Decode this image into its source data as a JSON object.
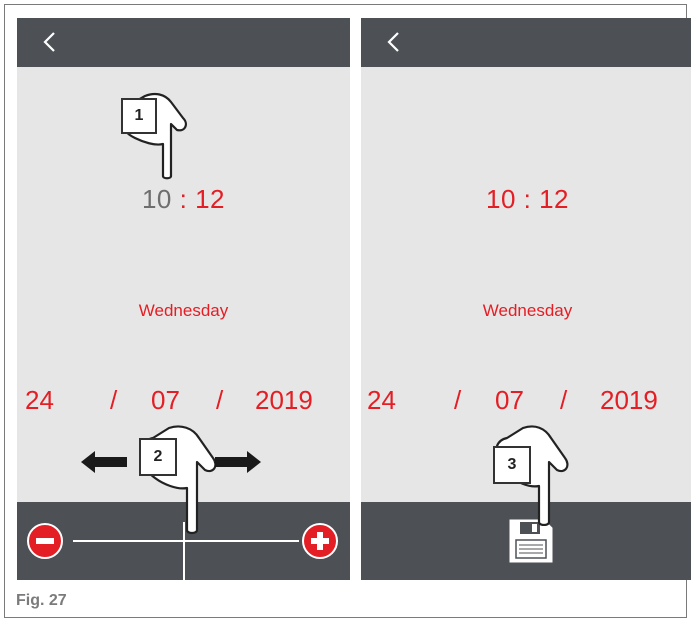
{
  "left_panel": {
    "time": {
      "hour": "10",
      "separator": ":",
      "minute": "12"
    },
    "day": "Wednesday",
    "date": {
      "day": "24",
      "sep1": "/",
      "month": "07",
      "sep2": "/",
      "year": "2019"
    },
    "callout_1": "1",
    "callout_2": "2"
  },
  "right_panel": {
    "time": "10 : 12",
    "day": "Wednesday",
    "date": {
      "day": "24",
      "sep1": "/",
      "month": "07",
      "sep2": "/",
      "year": "2019"
    },
    "callout_3": "3"
  },
  "caption": "Fig. 27",
  "colors": {
    "accent": "#e31e24",
    "bar": "#4d5156",
    "screen": "#e6e6e6",
    "hour_inactive": "#6e6e6e"
  },
  "icons": [
    "back-chevron-icon",
    "minus-icon",
    "plus-icon",
    "save-floppy-icon",
    "pointing-hand-icon",
    "arrow-left-icon",
    "arrow-right-icon"
  ]
}
